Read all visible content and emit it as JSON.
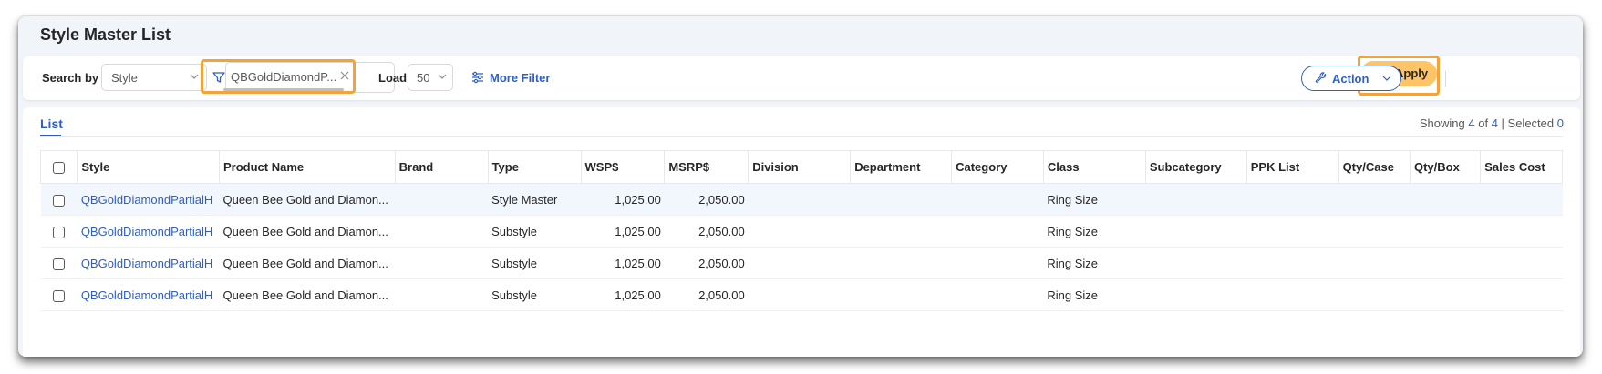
{
  "page": {
    "title": "Style Master List"
  },
  "search": {
    "label": "Search by",
    "field": "Style",
    "filter_value": "QBGoldDiamondP...",
    "load_label": "Load",
    "load_value": "50",
    "more_filter_label": "More Filter"
  },
  "actions": {
    "apply_label": "Apply",
    "action_label": "Action"
  },
  "list": {
    "tab_label": "List",
    "showing_prefix": "Showing",
    "showing_count": "4",
    "showing_of": "of",
    "showing_total": "4",
    "selected_label": "| Selected",
    "selected_count": "0"
  },
  "table": {
    "columns": [
      "Style",
      "Product Name",
      "Brand",
      "Type",
      "WSP$",
      "MSRP$",
      "Division",
      "Department",
      "Category",
      "Class",
      "Subcategory",
      "PPK List",
      "Qty/Case",
      "Qty/Box",
      "Sales Cost"
    ],
    "rows": [
      {
        "style": "QBGoldDiamondPartialH",
        "product": "Queen Bee Gold and Diamon...",
        "brand": "",
        "type": "Style Master",
        "wsp": "1,025.00",
        "msrp": "2,050.00",
        "division": "",
        "department": "",
        "category": "",
        "class": "Ring Size",
        "subcategory": "",
        "ppk": "",
        "qty_case": "",
        "qty_box": "",
        "sales_cost": ""
      },
      {
        "style": "QBGoldDiamondPartialH",
        "product": "Queen Bee Gold and Diamon...",
        "brand": "",
        "type": "Substyle",
        "wsp": "1,025.00",
        "msrp": "2,050.00",
        "division": "",
        "department": "",
        "category": "",
        "class": "Ring Size",
        "subcategory": "",
        "ppk": "",
        "qty_case": "",
        "qty_box": "",
        "sales_cost": ""
      },
      {
        "style": "QBGoldDiamondPartialH",
        "product": "Queen Bee Gold and Diamon...",
        "brand": "",
        "type": "Substyle",
        "wsp": "1,025.00",
        "msrp": "2,050.00",
        "division": "",
        "department": "",
        "category": "",
        "class": "Ring Size",
        "subcategory": "",
        "ppk": "",
        "qty_case": "",
        "qty_box": "",
        "sales_cost": ""
      },
      {
        "style": "QBGoldDiamondPartialH",
        "product": "Queen Bee Gold and Diamon...",
        "brand": "",
        "type": "Substyle",
        "wsp": "1,025.00",
        "msrp": "2,050.00",
        "division": "",
        "department": "",
        "category": "",
        "class": "Ring Size",
        "subcategory": "",
        "ppk": "",
        "qty_case": "",
        "qty_box": "",
        "sales_cost": ""
      }
    ]
  },
  "colors": {
    "accent": "#2f5fc4",
    "apply": "#ffc466",
    "highlight": "#f2a33a",
    "row_alt": "#f2f6fd"
  },
  "icons": {
    "filter": "funnel-icon",
    "apply": "search-icon",
    "action": "wrench-icon",
    "more_filter": "sliders-icon"
  }
}
